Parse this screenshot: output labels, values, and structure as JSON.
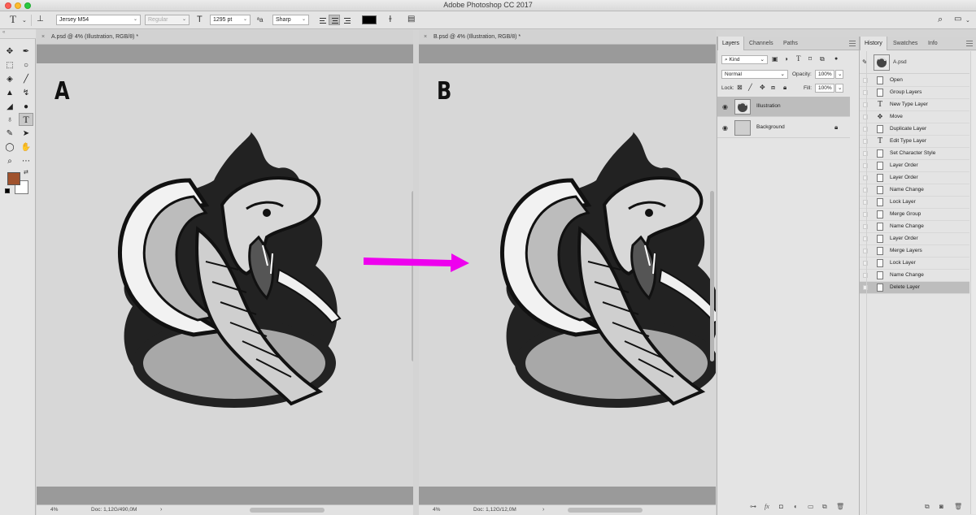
{
  "window": {
    "title": "Adobe Photoshop CC 2017"
  },
  "options_bar": {
    "tool_glyph": "T",
    "font_family": "Jersey M54",
    "font_style": "Regular",
    "font_size": "1295 pt",
    "anti_alias": "Sharp",
    "text_color": "#000000"
  },
  "tools": {
    "foreground_color": "#a0522d",
    "background_color": "#ffffff"
  },
  "documents": [
    {
      "tab_label": "A.psd @ 4% (Illustration, RGB/8) *",
      "letter": "A",
      "zoom": "4%",
      "doc_info": "Doc: 1,12G/490,0M"
    },
    {
      "tab_label": "B.psd @ 4% (Illustration, RGB/8) *",
      "letter": "B",
      "zoom": "4%",
      "doc_info": "Doc: 1,12G/12,0M"
    }
  ],
  "arrow_color": "#ee00ee",
  "layers_panel": {
    "tabs": [
      "Layers",
      "Channels",
      "Paths"
    ],
    "filter_kind": "Kind",
    "blend_mode": "Normal",
    "opacity_label": "Opacity:",
    "opacity": "100%",
    "lock_label": "Lock:",
    "fill_label": "Fill:",
    "fill": "100%",
    "layers": [
      {
        "name": "Illustration",
        "selected": true
      },
      {
        "name": "Background",
        "selected": false
      }
    ]
  },
  "history_panel": {
    "tabs": [
      "History",
      "Swatches",
      "Info"
    ],
    "snapshot": "A.psd",
    "items": [
      {
        "label": "Open",
        "icon": "doc"
      },
      {
        "label": "Group Layers",
        "icon": "doc"
      },
      {
        "label": "New Type Layer",
        "icon": "type"
      },
      {
        "label": "Move",
        "icon": "move"
      },
      {
        "label": "Duplicate Layer",
        "icon": "doc"
      },
      {
        "label": "Edit Type Layer",
        "icon": "type"
      },
      {
        "label": "Set Character Style",
        "icon": "doc"
      },
      {
        "label": "Layer Order",
        "icon": "doc"
      },
      {
        "label": "Layer Order",
        "icon": "doc"
      },
      {
        "label": "Name Change",
        "icon": "doc"
      },
      {
        "label": "Lock Layer",
        "icon": "doc"
      },
      {
        "label": "Merge Group",
        "icon": "doc"
      },
      {
        "label": "Name Change",
        "icon": "doc"
      },
      {
        "label": "Layer Order",
        "icon": "doc"
      },
      {
        "label": "Merge Layers",
        "icon": "doc"
      },
      {
        "label": "Lock Layer",
        "icon": "doc"
      },
      {
        "label": "Name Change",
        "icon": "doc"
      },
      {
        "label": "Delete Layer",
        "icon": "doc",
        "selected": true
      }
    ]
  }
}
